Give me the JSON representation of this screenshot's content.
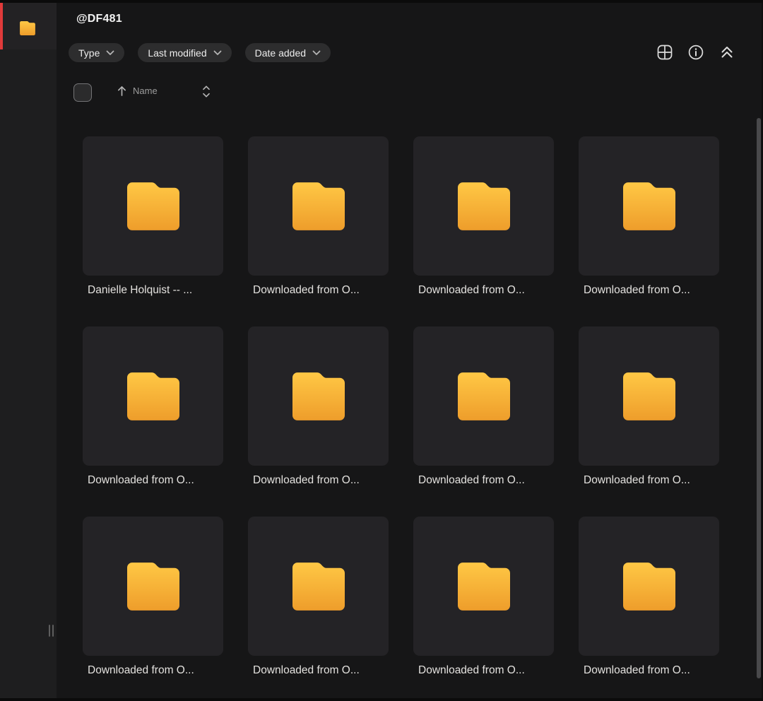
{
  "header": {
    "title": "@DF481",
    "filters": [
      {
        "label": "Type"
      },
      {
        "label": "Last modified"
      },
      {
        "label": "Date added"
      }
    ],
    "actions": [
      {
        "icon": "grid-view-icon"
      },
      {
        "icon": "info-icon"
      },
      {
        "icon": "collapse-up-icon"
      }
    ]
  },
  "list_controls": {
    "sort_field": "Name",
    "sort_direction": "ascending",
    "select_all_checked": false
  },
  "sidebar": {
    "selected_item": {
      "icon": "folder-icon",
      "accent_color": "#e03a3a"
    }
  },
  "grid": {
    "items": [
      {
        "label": "Danielle Holquist -- ..."
      },
      {
        "label": "Downloaded from O..."
      },
      {
        "label": "Downloaded from O..."
      },
      {
        "label": "Downloaded from O..."
      },
      {
        "label": "Downloaded from O..."
      },
      {
        "label": "Downloaded from O..."
      },
      {
        "label": "Downloaded from O..."
      },
      {
        "label": "Downloaded from O..."
      },
      {
        "label": "Downloaded from O..."
      },
      {
        "label": "Downloaded from O..."
      },
      {
        "label": "Downloaded from O..."
      },
      {
        "label": "Downloaded from O..."
      }
    ]
  },
  "colors": {
    "frame": "#0b0b0b",
    "main_bg": "#161617",
    "sidebar_bg": "#1e1e1f",
    "sidebar_selected_bg": "#232224",
    "card_bg": "#242326",
    "chip_bg": "#2d2d2e",
    "accent_red": "#e03a3a",
    "folder_gradient_top": "#ffc845",
    "folder_gradient_bottom": "#ee9d2b",
    "scrollbar_thumb": "#49494b"
  }
}
